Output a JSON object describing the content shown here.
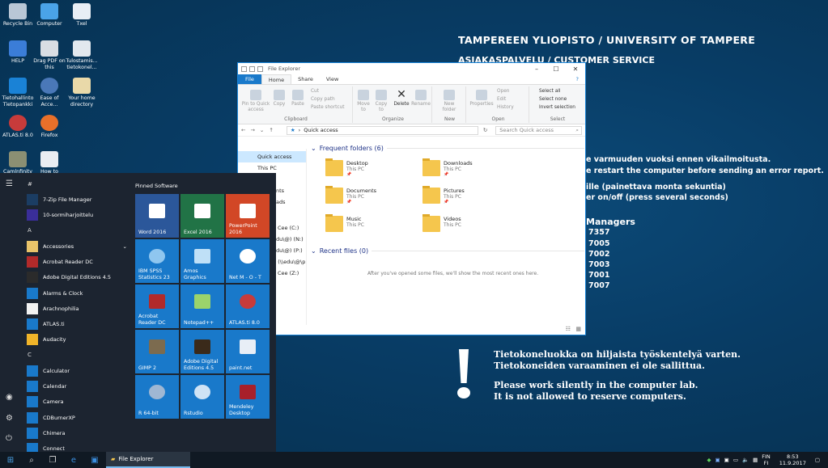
{
  "desktop": {
    "icons": [
      {
        "label": "Recycle Bin"
      },
      {
        "label": "Computer"
      },
      {
        "label": "Txel"
      },
      {
        "label": "HELP"
      },
      {
        "label": "Drag PDF on this"
      },
      {
        "label": "Tulostamis... tietokonel..."
      },
      {
        "label": "Tietohallinto Tietopankki"
      },
      {
        "label": "Ease of Acce..."
      },
      {
        "label": "Your home directory"
      },
      {
        "label": "ATLAS.ti 8.0"
      },
      {
        "label": "Firefox"
      },
      {
        "label": "Camlnfinity"
      },
      {
        "label": "How to"
      }
    ],
    "wallpaper": {
      "title": "TAMPEREEN YLIOPISTO / UNIVERSITY OF TAMPERE",
      "subtitle": "ASIAKASPALVELU / CUSTOMER SERVICE",
      "lines": [
        "e varmuuden vuoksi ennen vikailmoitusta.",
        "e restart the computer before sending an error report.",
        "ille (painettava monta sekuntia)",
        "er on/off (press several seconds)"
      ],
      "managers": "Managers",
      "numbers": [
        "7357",
        "7005",
        "7002",
        "7003",
        "7001",
        "7007"
      ],
      "fin1": "Tietokoneluokka on hiljaista työskentelyä varten.",
      "fin2": "Tietokoneiden varaaminen ei ole sallittua.",
      "eng1": "Please work silently in the computer lab.",
      "eng2": "It is not allowed to reserve computers."
    }
  },
  "explorer": {
    "title": "File Explorer",
    "tabs": [
      "File",
      "Home",
      "Share",
      "View"
    ],
    "ribbon": {
      "pin": "Pin to Quick access",
      "copy": "Copy",
      "paste": "Paste",
      "cut": "Cut",
      "copy_path": "Copy path",
      "paste_shortcut": "Paste shortcut",
      "clipboard": "Clipboard",
      "move_to": "Move to",
      "copy_to": "Copy to",
      "delete": "Delete",
      "rename": "Rename",
      "organize": "Organize",
      "new_folder": "New folder",
      "new": "New",
      "properties": "Properties",
      "open": "Open",
      "edit": "Edit",
      "history": "History",
      "open_group": "Open",
      "select_all": "Select all",
      "select_none": "Select none",
      "invert": "Invert selection",
      "select": "Select"
    },
    "address": "Quick access",
    "search_placeholder": "Search Quick access",
    "nav": [
      {
        "label": "Quick access"
      },
      {
        "label": "This PC"
      },
      {
        "label": "p"
      },
      {
        "label": "ents"
      },
      {
        "label": "oads"
      },
      {
        "label": "s"
      },
      {
        "label": "Cee (C:)"
      },
      {
        "label": "edu\\@) (N:)"
      },
      {
        "label": "edu\\@) (P:)"
      },
      {
        "label": "3 (\\\\edu\\@\\p"
      },
      {
        "label": "Cee (Z:)"
      }
    ],
    "frequent_header": "Frequent folders (6)",
    "folders": [
      {
        "name": "Desktop",
        "loc": "This PC",
        "pinned": true
      },
      {
        "name": "Downloads",
        "loc": "This PC",
        "pinned": true
      },
      {
        "name": "Documents",
        "loc": "This PC",
        "pinned": true
      },
      {
        "name": "Pictures",
        "loc": "This PC",
        "pinned": true
      },
      {
        "name": "Music",
        "loc": "This PC",
        "pinned": false
      },
      {
        "name": "Videos",
        "loc": "This PC",
        "pinned": false
      }
    ],
    "recent_header": "Recent files (0)",
    "recent_empty": "After you've opened some files, we'll show the most recent ones here."
  },
  "start_menu": {
    "pinned_header": "Pinned Software",
    "letters": [
      "#",
      "A",
      "C"
    ],
    "apps": [
      {
        "label": "7-Zip File Manager"
      },
      {
        "label": "10-sormiharjoittelu"
      },
      {
        "label": "Accessories"
      },
      {
        "label": "Acrobat Reader DC"
      },
      {
        "label": "Adobe Digital Editions 4.5"
      },
      {
        "label": "Alarms & Clock"
      },
      {
        "label": "Arachnophilia"
      },
      {
        "label": "ATLAS.ti"
      },
      {
        "label": "Audacity"
      },
      {
        "label": "Calculator"
      },
      {
        "label": "Calendar"
      },
      {
        "label": "Camera"
      },
      {
        "label": "CDBurnerXP"
      },
      {
        "label": "Chimera"
      },
      {
        "label": "Connect"
      }
    ],
    "tiles": [
      {
        "label": "Word 2016",
        "color": "#2b579a"
      },
      {
        "label": "Excel 2016",
        "color": "#217346"
      },
      {
        "label": "PowerPoint 2016",
        "color": "#d24726"
      },
      {
        "label": "IBM SPSS Statistics 23",
        "color": "#1979ca"
      },
      {
        "label": "Amos Graphics",
        "color": "#1979ca"
      },
      {
        "label": "Net M - O - T",
        "color": "#1979ca"
      },
      {
        "label": "Acrobat Reader DC",
        "color": "#1979ca"
      },
      {
        "label": "Notepad++",
        "color": "#1979ca"
      },
      {
        "label": "ATLAS.ti 8.0",
        "color": "#1979ca"
      },
      {
        "label": "GIMP 2",
        "color": "#1979ca"
      },
      {
        "label": "Adobe Digital Editions 4.5",
        "color": "#1979ca"
      },
      {
        "label": "paint.net",
        "color": "#1979ca"
      },
      {
        "label": "R 64-bit",
        "color": "#1979ca"
      },
      {
        "label": "Rstudio",
        "color": "#1979ca"
      },
      {
        "label": "Mendeley Desktop",
        "color": "#1979ca"
      }
    ]
  },
  "taskbar": {
    "active_app": "File Explorer",
    "lang": "FIN",
    "lang2": "FI",
    "time": "8:53",
    "date": "11.9.2017"
  }
}
